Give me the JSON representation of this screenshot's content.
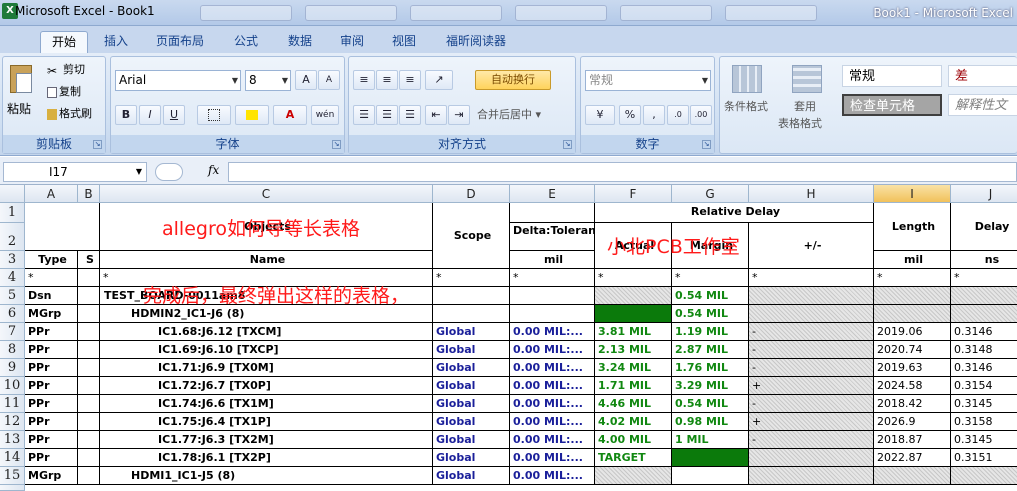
{
  "window": {
    "title": "Microsoft Excel - Book1",
    "title_right": "Book1 - Microsoft Excel"
  },
  "tabs": [
    "开始",
    "插入",
    "页面布局",
    "公式",
    "数据",
    "审阅",
    "视图",
    "福昕阅读器"
  ],
  "ribbon": {
    "clipboard": {
      "label": "剪贴板",
      "paste": "粘贴",
      "cut": "剪切",
      "copy": "复制",
      "format_painter": "格式刷"
    },
    "font": {
      "label": "字体",
      "name": "Arial",
      "size": "8",
      "grow": "A",
      "shrink": "A",
      "bold": "B",
      "italic": "I",
      "underline": "U",
      "font_color": "A",
      "phonetic": "wén"
    },
    "alignment": {
      "label": "对齐方式",
      "wrap_text": "自动换行",
      "merge_center": "合并后居中"
    },
    "number": {
      "label": "数字",
      "format": "常规",
      "percent": "%",
      "comma": ",",
      "decrease": ".0",
      "increase": ".00"
    },
    "styles": {
      "conditional": "条件格式",
      "table_format_1": "套用",
      "table_format_2": "表格格式",
      "normal": "常规",
      "bad": "差",
      "check_cell": "检查单元格",
      "explanatory": "解释性文字"
    }
  },
  "formula_bar": {
    "name_box": "I17",
    "fx": "fx"
  },
  "columns": [
    "A",
    "B",
    "C",
    "D",
    "E",
    "F",
    "G",
    "H",
    "I",
    "J"
  ],
  "rows": [
    "1",
    "2",
    "3",
    "4",
    "5",
    "6",
    "7",
    "8",
    "9",
    "10",
    "11",
    "12",
    "13",
    "14",
    "15"
  ],
  "header": {
    "objects": "Objects",
    "scope": "Scope",
    "delta": "Delta:Tolerance",
    "relative_delay": "Relative Delay",
    "actual": "Actual",
    "margin": "Margin",
    "plusminus": "+/-",
    "length": "Length",
    "delay": "Delay",
    "type": "Type",
    "s": "S",
    "name": "Name",
    "mil_e": "mil",
    "mil_i": "mil",
    "ns": "ns",
    "star": "*"
  },
  "data_rows": [
    {
      "type": "Dsn",
      "name": "TEST_BOARD-0011am8",
      "indent": 0,
      "scope": "",
      "delta": "",
      "actual": "",
      "margin": "0.54 MIL",
      "pm": "",
      "length": "",
      "delay": "",
      "actual_fill": "",
      "margin_fill": ""
    },
    {
      "type": "MGrp",
      "name": "HDMIN2_IC1-J6 (8)",
      "indent": 1,
      "scope": "",
      "delta": "",
      "actual": "",
      "margin": "0.54 MIL",
      "pm": "",
      "length": "",
      "delay": "",
      "actual_fill": "green",
      "margin_fill": ""
    },
    {
      "type": "PPr",
      "name": "IC1.68:J6.12 [TXCM]",
      "indent": 2,
      "scope": "Global",
      "delta": "0.00 MIL:...",
      "actual": "3.81 MIL",
      "margin": "1.19 MIL",
      "pm": "-",
      "length": "2019.06",
      "delay": "0.3146",
      "actual_fill": "",
      "margin_fill": ""
    },
    {
      "type": "PPr",
      "name": "IC1.69:J6.10 [TXCP]",
      "indent": 2,
      "scope": "Global",
      "delta": "0.00 MIL:...",
      "actual": "2.13 MIL",
      "margin": "2.87 MIL",
      "pm": "-",
      "length": "2020.74",
      "delay": "0.3148",
      "actual_fill": "",
      "margin_fill": ""
    },
    {
      "type": "PPr",
      "name": "IC1.71:J6.9 [TX0M]",
      "indent": 2,
      "scope": "Global",
      "delta": "0.00 MIL:...",
      "actual": "3.24 MIL",
      "margin": "1.76 MIL",
      "pm": "-",
      "length": "2019.63",
      "delay": "0.3146",
      "actual_fill": "",
      "margin_fill": ""
    },
    {
      "type": "PPr",
      "name": "IC1.72:J6.7 [TX0P]",
      "indent": 2,
      "scope": "Global",
      "delta": "0.00 MIL:...",
      "actual": "1.71 MIL",
      "margin": "3.29 MIL",
      "pm": "+",
      "length": "2024.58",
      "delay": "0.3154",
      "actual_fill": "",
      "margin_fill": ""
    },
    {
      "type": "PPr",
      "name": "IC1.74:J6.6 [TX1M]",
      "indent": 2,
      "scope": "Global",
      "delta": "0.00 MIL:...",
      "actual": "4.46 MIL",
      "margin": "0.54 MIL",
      "pm": "-",
      "length": "2018.42",
      "delay": "0.3145",
      "actual_fill": "",
      "margin_fill": ""
    },
    {
      "type": "PPr",
      "name": "IC1.75:J6.4 [TX1P]",
      "indent": 2,
      "scope": "Global",
      "delta": "0.00 MIL:...",
      "actual": "4.02 MIL",
      "margin": "0.98 MIL",
      "pm": "+",
      "length": "2026.9",
      "delay": "0.3158",
      "actual_fill": "",
      "margin_fill": ""
    },
    {
      "type": "PPr",
      "name": "IC1.77:J6.3 [TX2M]",
      "indent": 2,
      "scope": "Global",
      "delta": "0.00 MIL:...",
      "actual": "4.00 MIL",
      "margin": "1 MIL",
      "pm": "-",
      "length": "2018.87",
      "delay": "0.3145",
      "actual_fill": "",
      "margin_fill": ""
    },
    {
      "type": "PPr",
      "name": "IC1.78:J6.1 [TX2P]",
      "indent": 2,
      "scope": "Global",
      "delta": "0.00 MIL:...",
      "actual": "TARGET",
      "margin": "",
      "pm": "",
      "length": "2022.87",
      "delay": "0.3151",
      "actual_fill": "",
      "margin_fill": "green"
    },
    {
      "type": "MGrp",
      "name": "HDMI1_IC1-J5 (8)",
      "indent": 1,
      "scope": "Global",
      "delta": "0.00 MIL:...",
      "actual": "",
      "margin": "",
      "pm": "",
      "length": "",
      "delay": "",
      "actual_fill": "",
      "margin_fill": ""
    }
  ],
  "overlay": {
    "title": "allegro如何导等长表格",
    "studio": "小北PCB工作室",
    "caption": "完成后，最终弹出这样的表格，"
  },
  "colors": {
    "accent": "#15428b",
    "green_fill": "#0b7a0b",
    "blue_text": "#1a1f9a",
    "green_text": "#118811",
    "overlay_red": "#ff1a1a"
  }
}
